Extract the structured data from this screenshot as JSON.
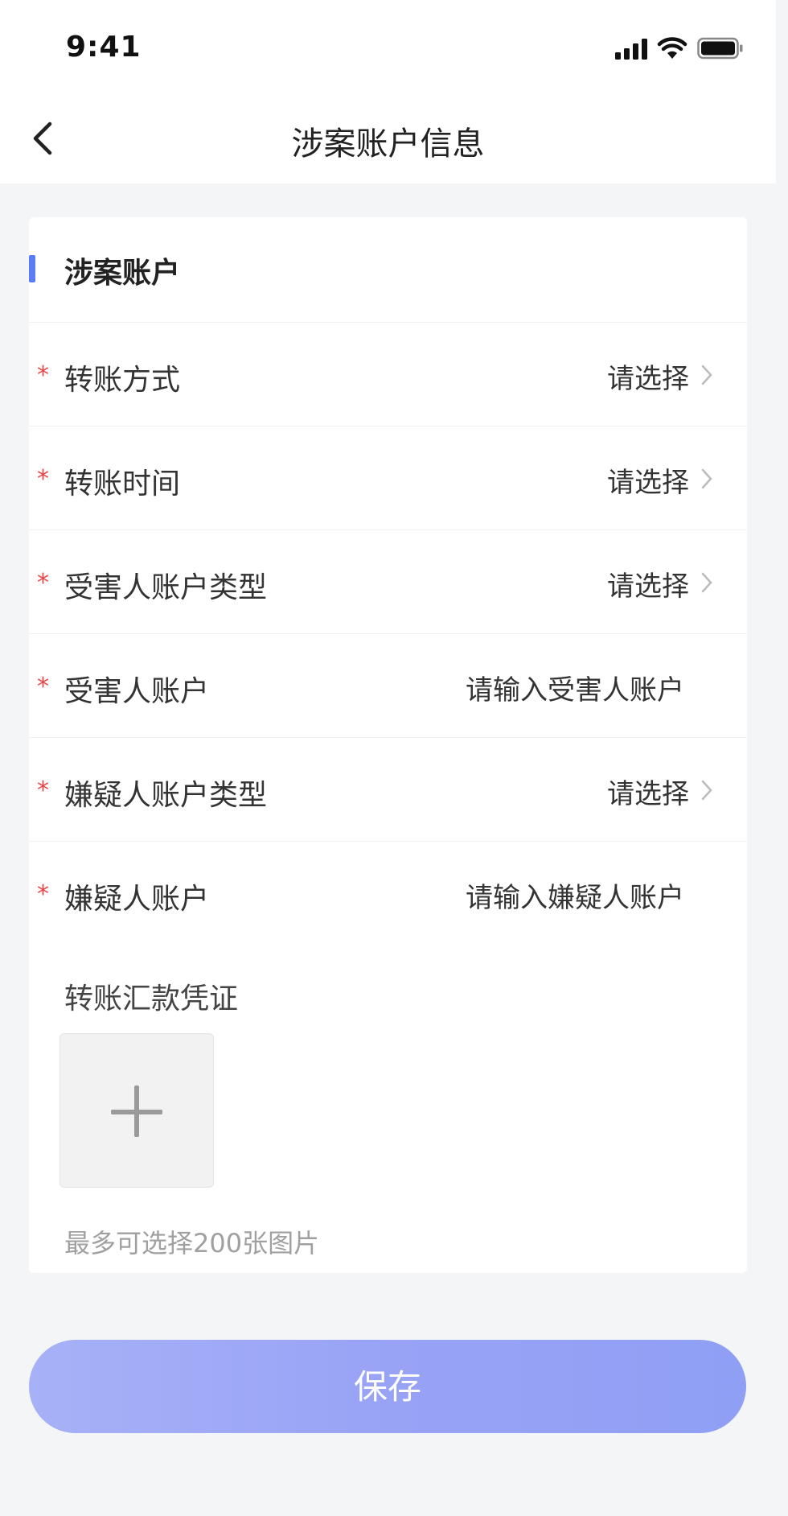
{
  "status_bar": {
    "time": "9:41"
  },
  "nav": {
    "title": "涉案账户信息"
  },
  "section": {
    "title": "涉案账户"
  },
  "rows": [
    {
      "required": "*",
      "label": "转账方式",
      "value": "请选择",
      "type": "select"
    },
    {
      "required": "*",
      "label": "转账时间",
      "value": "请选择",
      "type": "select"
    },
    {
      "required": "*",
      "label": "受害人账户类型",
      "value": "请选择",
      "type": "select"
    },
    {
      "required": "*",
      "label": "受害人账户",
      "value": "请输入受害人账户",
      "type": "input"
    },
    {
      "required": "*",
      "label": "嫌疑人账户类型",
      "value": "请选择",
      "type": "select"
    },
    {
      "required": "*",
      "label": "嫌疑人账户",
      "value": "请输入嫌疑人账户",
      "type": "input"
    }
  ],
  "upload": {
    "label": "转账汇款凭证",
    "hint": "最多可选择200张图片",
    "icon": "plus-icon"
  },
  "actions": {
    "save_label": "保存"
  },
  "colors": {
    "accent": "#5b7cf7",
    "required": "#e84545",
    "button": "#98a3f6"
  }
}
